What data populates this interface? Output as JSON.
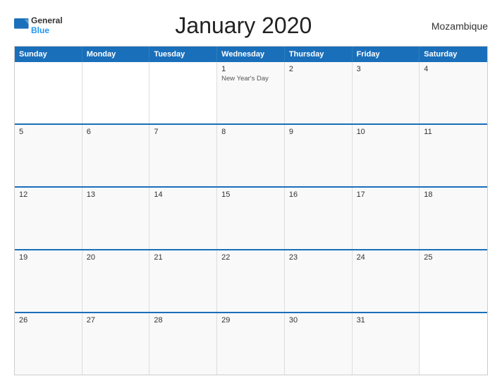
{
  "header": {
    "title": "January 2020",
    "country": "Mozambique",
    "logo": {
      "line1": "General",
      "line2": "Blue"
    }
  },
  "calendar": {
    "day_names": [
      "Sunday",
      "Monday",
      "Tuesday",
      "Wednesday",
      "Thursday",
      "Friday",
      "Saturday"
    ],
    "weeks": [
      [
        {
          "day": "",
          "empty": true
        },
        {
          "day": "",
          "empty": true
        },
        {
          "day": "",
          "empty": true
        },
        {
          "day": "1",
          "event": "New Year's Day"
        },
        {
          "day": "2",
          "event": ""
        },
        {
          "day": "3",
          "event": ""
        },
        {
          "day": "4",
          "event": ""
        }
      ],
      [
        {
          "day": "5",
          "event": ""
        },
        {
          "day": "6",
          "event": ""
        },
        {
          "day": "7",
          "event": ""
        },
        {
          "day": "8",
          "event": ""
        },
        {
          "day": "9",
          "event": ""
        },
        {
          "day": "10",
          "event": ""
        },
        {
          "day": "11",
          "event": ""
        }
      ],
      [
        {
          "day": "12",
          "event": ""
        },
        {
          "day": "13",
          "event": ""
        },
        {
          "day": "14",
          "event": ""
        },
        {
          "day": "15",
          "event": ""
        },
        {
          "day": "16",
          "event": ""
        },
        {
          "day": "17",
          "event": ""
        },
        {
          "day": "18",
          "event": ""
        }
      ],
      [
        {
          "day": "19",
          "event": ""
        },
        {
          "day": "20",
          "event": ""
        },
        {
          "day": "21",
          "event": ""
        },
        {
          "day": "22",
          "event": ""
        },
        {
          "day": "23",
          "event": ""
        },
        {
          "day": "24",
          "event": ""
        },
        {
          "day": "25",
          "event": ""
        }
      ],
      [
        {
          "day": "26",
          "event": ""
        },
        {
          "day": "27",
          "event": ""
        },
        {
          "day": "28",
          "event": ""
        },
        {
          "day": "29",
          "event": ""
        },
        {
          "day": "30",
          "event": ""
        },
        {
          "day": "31",
          "event": ""
        },
        {
          "day": "",
          "empty": true
        }
      ]
    ]
  },
  "colors": {
    "header_bg": "#1a6fba",
    "accent": "#2196F3"
  }
}
